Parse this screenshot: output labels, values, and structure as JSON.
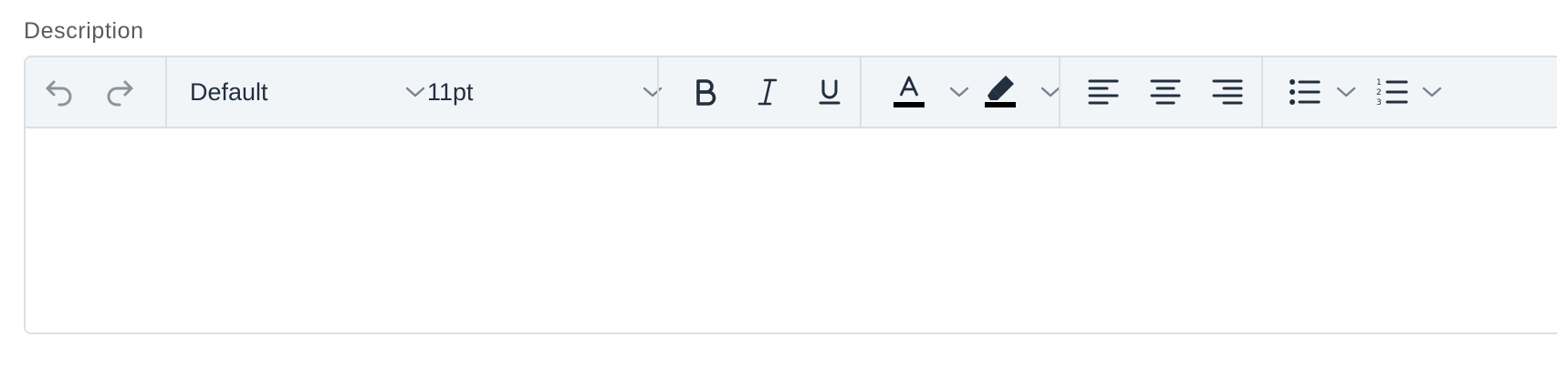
{
  "field": {
    "label": "Description"
  },
  "toolbar": {
    "undo_icon": "undo-icon",
    "redo_icon": "redo-icon",
    "font_family": {
      "value": "Default",
      "icon": "chevron-down-icon"
    },
    "font_size": {
      "value": "11pt",
      "icon": "chevron-down-icon"
    },
    "bold_icon": "bold-icon",
    "italic_icon": "italic-icon",
    "underline_icon": "underline-icon",
    "text_color_icon": "text-color-icon",
    "highlight_color_icon": "highlight-icon",
    "align_left_icon": "align-left-icon",
    "align_center_icon": "align-center-icon",
    "align_right_icon": "align-right-icon",
    "bullet_list_icon": "bullet-list-icon",
    "numbered_list_icon": "numbered-list-icon"
  },
  "colors": {
    "toolbar_bg": "#f2f5f8",
    "border": "#dcdfe3",
    "icon": "#222f3e",
    "icon_disabled": "#8c939b",
    "chevron": "#7a8390"
  },
  "editor": {
    "content": ""
  }
}
